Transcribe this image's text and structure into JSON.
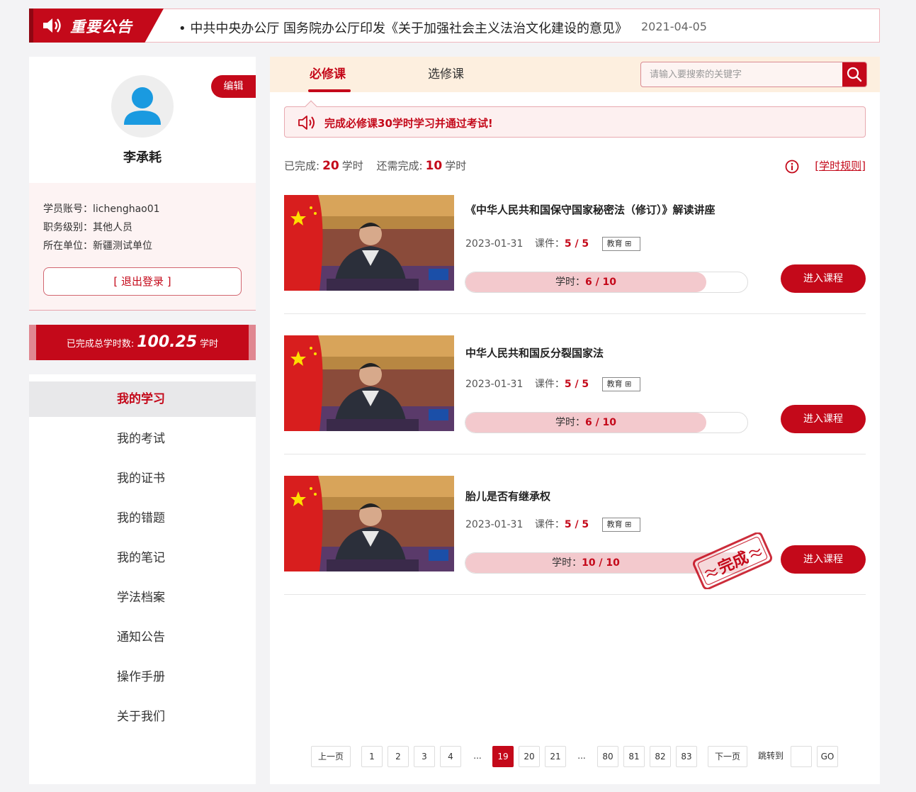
{
  "notice": {
    "badge": "重要公告",
    "text": "• 中共中央办公厅 国务院办公厅印发《关于加强社会主义法治文化建设的意见》",
    "date": "2021-04-05"
  },
  "profile": {
    "edit_label": "编辑",
    "name": "李承耗",
    "account_label": "学员账号：lichenghao01",
    "level_label": "职务级别：其他人员",
    "unit_label": "所在单位：新疆测试单位",
    "logout_label": "[ 退出登录 ]"
  },
  "hours": {
    "prefix": "已完成总学时数:",
    "value": "100.25",
    "unit": "学时"
  },
  "menu": {
    "items": [
      "我的学习",
      "我的考试",
      "我的证书",
      "我的错题",
      "我的笔记",
      "学法档案",
      "通知公告",
      "操作手册",
      "关于我们"
    ]
  },
  "tabs": [
    "必修课",
    "选修课"
  ],
  "search": {
    "placeholder": "请输入要搜索的关键字"
  },
  "tip": "完成必修课30学时学习并通过考试!",
  "summary": {
    "done_label": "已完成:",
    "done_value": "20",
    "unit": "学时",
    "need_label": "还需完成:",
    "need_value": "10",
    "rules": "[学时规则]"
  },
  "courses": [
    {
      "title": "《中华人民共和国保守国家秘密法（修订）》解读讲座",
      "date": "2023-01-31",
      "lessons_label": "课件：",
      "lessons": "5 / 5",
      "tag": "教育",
      "hours_label": "学时：",
      "hours": "6 / 10",
      "progress": 0.6,
      "button": "进入课程",
      "completed": false
    },
    {
      "title": "中华人民共和国反分裂国家法",
      "date": "2023-01-31",
      "lessons_label": "课件：",
      "lessons": "5 / 5",
      "tag": "教育",
      "hours_label": "学时：",
      "hours": "6 / 10",
      "progress": 0.6,
      "button": "进入课程",
      "completed": false
    },
    {
      "title": "胎儿是否有继承权",
      "date": "2023-01-31",
      "lessons_label": "课件：",
      "lessons": "5 / 5",
      "tag": "教育",
      "hours_label": "学时：",
      "hours": "10 / 10",
      "progress": 1.0,
      "button": "进入课程",
      "completed": true,
      "stamp": "完成"
    }
  ],
  "pager": {
    "prev": "上一页",
    "pages": [
      "1",
      "2",
      "3",
      "4",
      "...",
      "19",
      "20",
      "21",
      "...",
      "80",
      "81",
      "82",
      "83"
    ],
    "current": "19",
    "next": "下一页",
    "jump_label": "跳转到",
    "go": "GO"
  },
  "colors": {
    "accent": "#c4091a",
    "tabbar": "#fdefdf",
    "progress": "#f3c9cd"
  }
}
